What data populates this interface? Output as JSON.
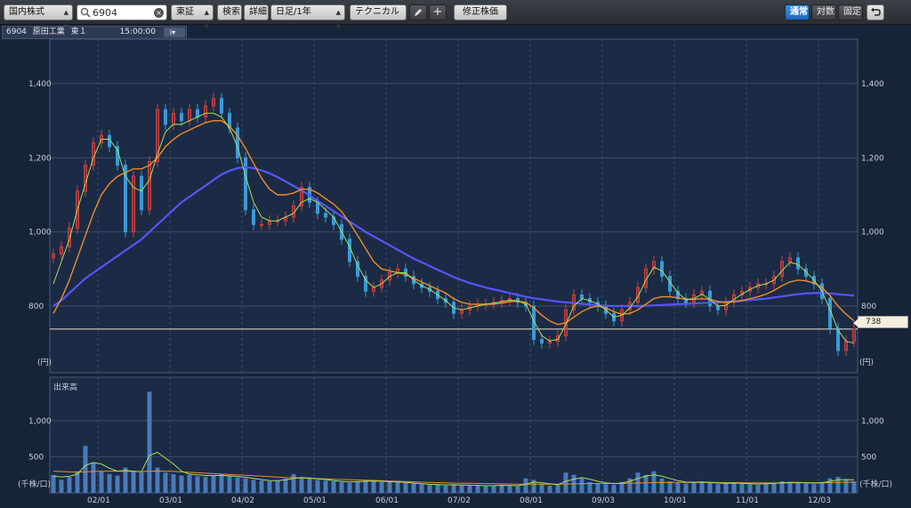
{
  "toolbar": {
    "market_select": "国内株式",
    "search_value": "6904",
    "exchange_select": "東証",
    "search_button": "検索",
    "detail_button": "詳細",
    "period_select": "日足/1年",
    "technical_button": "テクニカル",
    "adjusted_price_button": "修正株価",
    "scale_normal": "通常",
    "scale_log": "対数",
    "scale_fixed": "固定"
  },
  "info": {
    "code": "6904",
    "name": "原田工業",
    "market": "東１",
    "time": "15:00:00",
    "info_icon": "i▾"
  },
  "current_price": "738",
  "colors": {
    "background": "#16243a",
    "up_candle": "#d04040",
    "down_candle": "#3a9ad8",
    "ma_short": "#a6e05a",
    "ma_mid": "#f08c28",
    "ma_long": "#5555ff",
    "volume_bar": "#4a7ab8"
  },
  "chart_data": [
    {
      "type": "candlestick",
      "x_ticks": [
        "02/01",
        "03/01",
        "04/02",
        "05/01",
        "06/01",
        "07/02",
        "08/01",
        "09/03",
        "10/01",
        "11/01",
        "12/03"
      ],
      "y_ticks": [
        800,
        1000,
        1200,
        1400
      ],
      "y_tick_labels": [
        "800",
        "1,000",
        "1,200",
        "1,400"
      ],
      "ylabel": "(円)",
      "ylim": [
        620,
        1520
      ],
      "close": [
        940,
        960,
        1010,
        1110,
        1180,
        1240,
        1260,
        1230,
        1180,
        1000,
        1150,
        1060,
        1190,
        1330,
        1290,
        1320,
        1300,
        1330,
        1310,
        1340,
        1360,
        1320,
        1280,
        1200,
        1060,
        1020,
        1020,
        1030,
        1030,
        1040,
        1070,
        1120,
        1080,
        1050,
        1040,
        1020,
        980,
        920,
        880,
        840,
        850,
        870,
        890,
        900,
        880,
        860,
        850,
        840,
        820,
        810,
        780,
        790,
        800,
        805,
        805,
        810,
        815,
        820,
        810,
        800,
        710,
        700,
        705,
        720,
        790,
        830,
        820,
        810,
        800,
        780,
        760,
        790,
        810,
        850,
        900,
        920,
        880,
        840,
        820,
        810,
        830,
        840,
        800,
        790,
        810,
        830,
        840,
        850,
        860,
        860,
        880,
        920,
        930,
        900,
        880,
        860,
        820,
        740,
        680,
        705,
        738
      ],
      "ma_short": [
        860,
        920,
        980,
        1060,
        1130,
        1200,
        1250,
        1250,
        1220,
        1150,
        1120,
        1110,
        1140,
        1210,
        1270,
        1290,
        1290,
        1300,
        1310,
        1320,
        1320,
        1310,
        1280,
        1230,
        1150,
        1080,
        1040,
        1030,
        1030,
        1040,
        1050,
        1080,
        1090,
        1080,
        1060,
        1040,
        1000,
        960,
        910,
        870,
        850,
        860,
        880,
        890,
        890,
        870,
        855,
        845,
        830,
        815,
        795,
        790,
        795,
        800,
        805,
        808,
        812,
        816,
        814,
        805,
        760,
        720,
        706,
        710,
        750,
        800,
        820,
        815,
        805,
        790,
        770,
        775,
        795,
        825,
        870,
        905,
        895,
        865,
        835,
        818,
        820,
        832,
        818,
        800,
        802,
        818,
        832,
        845,
        855,
        860,
        870,
        895,
        918,
        912,
        892,
        870,
        840,
        790,
        735,
        705,
        700
      ],
      "ma_mid": [
        780,
        820,
        870,
        930,
        990,
        1050,
        1100,
        1130,
        1150,
        1160,
        1170,
        1170,
        1180,
        1200,
        1230,
        1250,
        1265,
        1275,
        1285,
        1295,
        1300,
        1300,
        1285,
        1260,
        1225,
        1185,
        1145,
        1115,
        1100,
        1100,
        1105,
        1115,
        1115,
        1105,
        1090,
        1075,
        1055,
        1025,
        990,
        955,
        920,
        900,
        895,
        890,
        885,
        875,
        865,
        855,
        845,
        835,
        820,
        810,
        805,
        805,
        805,
        805,
        808,
        812,
        813,
        810,
        795,
        775,
        760,
        750,
        755,
        770,
        785,
        795,
        800,
        795,
        785,
        778,
        780,
        790,
        805,
        820,
        825,
        825,
        822,
        818,
        818,
        820,
        818,
        812,
        810,
        812,
        815,
        820,
        825,
        832,
        842,
        855,
        865,
        870,
        868,
        862,
        850,
        828,
        800,
        778,
        760
      ],
      "ma_long": [
        800,
        815,
        835,
        855,
        875,
        890,
        905,
        920,
        935,
        950,
        965,
        980,
        1000,
        1020,
        1040,
        1060,
        1080,
        1095,
        1110,
        1125,
        1140,
        1155,
        1165,
        1172,
        1175,
        1172,
        1166,
        1158,
        1148,
        1136,
        1124,
        1112,
        1098,
        1084,
        1070,
        1056,
        1042,
        1028,
        1014,
        1000,
        988,
        976,
        964,
        952,
        940,
        928,
        918,
        908,
        898,
        888,
        878,
        870,
        862,
        856,
        850,
        845,
        840,
        835,
        830,
        825,
        821,
        818,
        815,
        812,
        810,
        808,
        806,
        804,
        802,
        801,
        800,
        800,
        800,
        800,
        801,
        802,
        803,
        804,
        805,
        806,
        807,
        808,
        809,
        810,
        811,
        812,
        814,
        816,
        818,
        820,
        823,
        826,
        829,
        832,
        834,
        835,
        835,
        834,
        832,
        830,
        828
      ]
    },
    {
      "type": "bar",
      "title": "出来高",
      "y_ticks": [
        500,
        1000
      ],
      "y_tick_labels": [
        "500",
        "1,000"
      ],
      "ylabel": "(千株/口)",
      "ylim": [
        0,
        1600
      ],
      "values": [
        250,
        180,
        220,
        300,
        650,
        420,
        300,
        260,
        240,
        350,
        300,
        280,
        1400,
        350,
        280,
        260,
        240,
        250,
        230,
        220,
        240,
        260,
        230,
        210,
        200,
        180,
        170,
        160,
        170,
        200,
        260,
        220,
        200,
        180,
        170,
        160,
        150,
        140,
        160,
        180,
        170,
        150,
        160,
        150,
        140,
        130,
        120,
        110,
        120,
        100,
        120,
        110,
        100,
        100,
        90,
        100,
        110,
        100,
        90,
        200,
        180,
        120,
        100,
        110,
        280,
        250,
        200,
        150,
        130,
        120,
        110,
        150,
        200,
        280,
        250,
        300,
        200,
        160,
        140,
        130,
        150,
        160,
        140,
        120,
        130,
        140,
        130,
        120,
        110,
        130,
        140,
        160,
        150,
        140,
        130,
        120,
        150,
        200,
        220,
        180,
        160
      ],
      "ma_short": [
        230,
        220,
        230,
        260,
        380,
        420,
        400,
        340,
        300,
        310,
        300,
        290,
        520,
        560,
        480,
        400,
        300,
        260,
        250,
        240,
        240,
        240,
        235,
        225,
        215,
        200,
        185,
        170,
        170,
        180,
        200,
        210,
        205,
        195,
        185,
        170,
        160,
        150,
        155,
        160,
        165,
        160,
        155,
        150,
        145,
        135,
        125,
        118,
        115,
        110,
        112,
        110,
        106,
        104,
        98,
        100,
        104,
        102,
        98,
        120,
        150,
        140,
        125,
        115,
        160,
        190,
        210,
        190,
        160,
        140,
        125,
        135,
        160,
        200,
        230,
        250,
        230,
        200,
        170,
        150,
        148,
        150,
        145,
        135,
        132,
        135,
        133,
        128,
        122,
        125,
        130,
        140,
        145,
        145,
        140,
        135,
        140,
        160,
        180,
        185,
        180
      ],
      "ma_long": [
        300,
        295,
        290,
        288,
        290,
        295,
        298,
        300,
        300,
        298,
        296,
        294,
        300,
        302,
        300,
        296,
        290,
        284,
        278,
        272,
        266,
        260,
        254,
        248,
        242,
        236,
        230,
        224,
        218,
        213,
        210,
        206,
        202,
        198,
        194,
        190,
        186,
        182,
        178,
        175,
        172,
        168,
        164,
        160,
        156,
        152,
        148,
        145,
        142,
        139,
        136,
        134,
        132,
        130,
        128,
        126,
        124,
        122,
        120,
        120,
        120,
        120,
        120,
        120,
        122,
        124,
        126,
        128,
        130,
        130,
        130,
        131,
        133,
        136,
        139,
        142,
        144,
        145,
        145,
        145,
        145,
        145,
        144,
        143,
        142,
        141,
        140,
        139,
        138,
        137,
        137,
        138,
        139,
        140,
        140,
        140,
        140,
        142,
        144,
        146,
        148
      ]
    }
  ]
}
